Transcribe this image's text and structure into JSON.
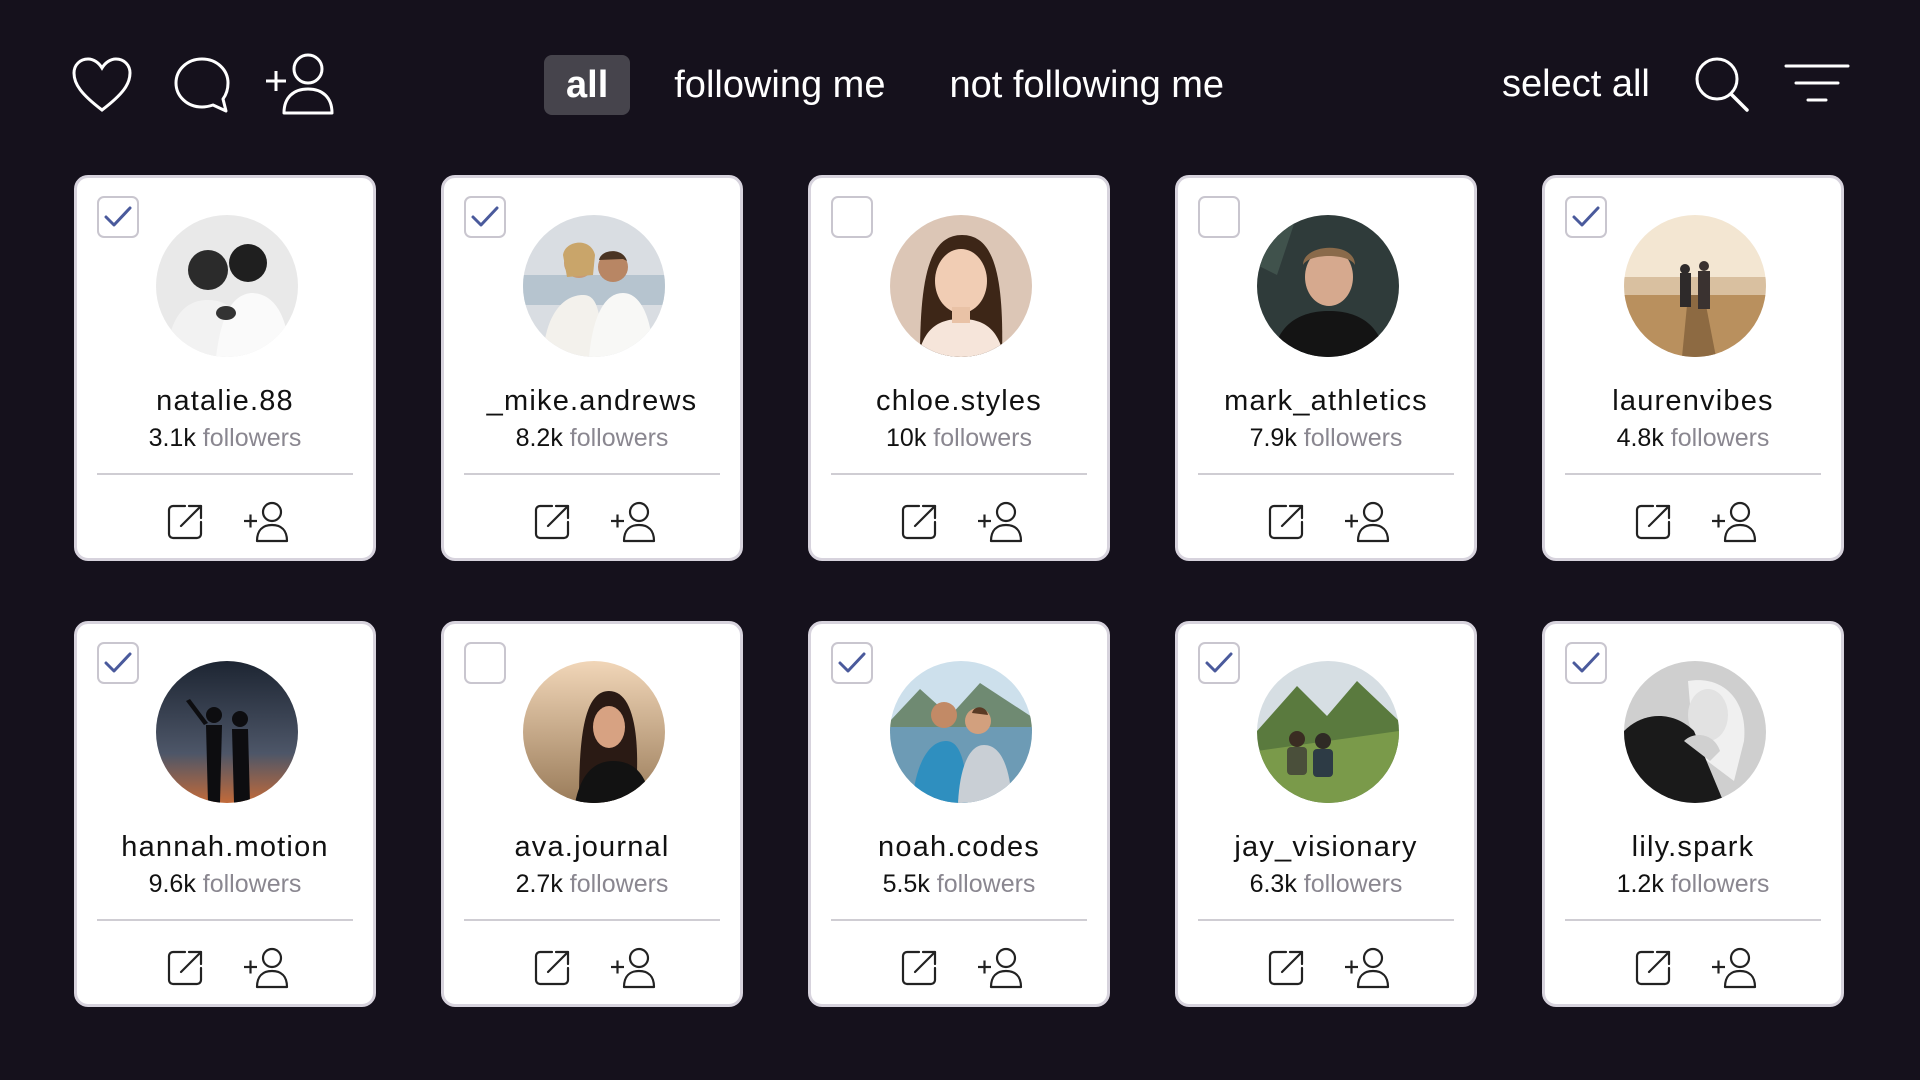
{
  "toolbar": {
    "icons": [
      "heart-icon",
      "chat-bubble-icon",
      "add-user-icon"
    ],
    "tabs": [
      {
        "label": "all",
        "active": true
      },
      {
        "label": "following me",
        "active": false
      },
      {
        "label": "not following me",
        "active": false
      }
    ],
    "select_all_label": "select all",
    "right_icons": [
      "search-icon",
      "filter-menu-icon"
    ]
  },
  "colors": {
    "background": "#15111c",
    "card": "#ffffff",
    "active_tab": "#46444c",
    "check": "#4a5a9c",
    "muted_text": "#8a8790"
  },
  "card_actions": {
    "open_icon": "open-external-icon",
    "follow_icon": "add-user-icon"
  },
  "profiles": [
    {
      "username": "natalie.88",
      "count": "3.1k",
      "label": "followers",
      "selected": true,
      "avatar": "couple-bw"
    },
    {
      "username": "_mike.andrews",
      "count": "8.2k",
      "label": "followers",
      "selected": true,
      "avatar": "couple-beach"
    },
    {
      "username": "chloe.styles",
      "count": "10k",
      "label": "followers",
      "selected": false,
      "avatar": "woman-portrait"
    },
    {
      "username": "mark_athletics",
      "count": "7.9k",
      "label": "followers",
      "selected": false,
      "avatar": "man-portrait"
    },
    {
      "username": "laurenvibes",
      "count": "4.8k",
      "label": "followers",
      "selected": true,
      "avatar": "couple-sunset-beach"
    },
    {
      "username": "hannah.motion",
      "count": "9.6k",
      "label": "followers",
      "selected": true,
      "avatar": "silhouette-dance"
    },
    {
      "username": "ava.journal",
      "count": "2.7k",
      "label": "followers",
      "selected": false,
      "avatar": "woman-sunset"
    },
    {
      "username": "noah.codes",
      "count": "5.5k",
      "label": "followers",
      "selected": true,
      "avatar": "couple-lake"
    },
    {
      "username": "jay_visionary",
      "count": "6.3k",
      "label": "followers",
      "selected": true,
      "avatar": "hikers-mountain"
    },
    {
      "username": "lily.spark",
      "count": "1.2k",
      "label": "followers",
      "selected": true,
      "avatar": "woman-bw-hug"
    }
  ]
}
